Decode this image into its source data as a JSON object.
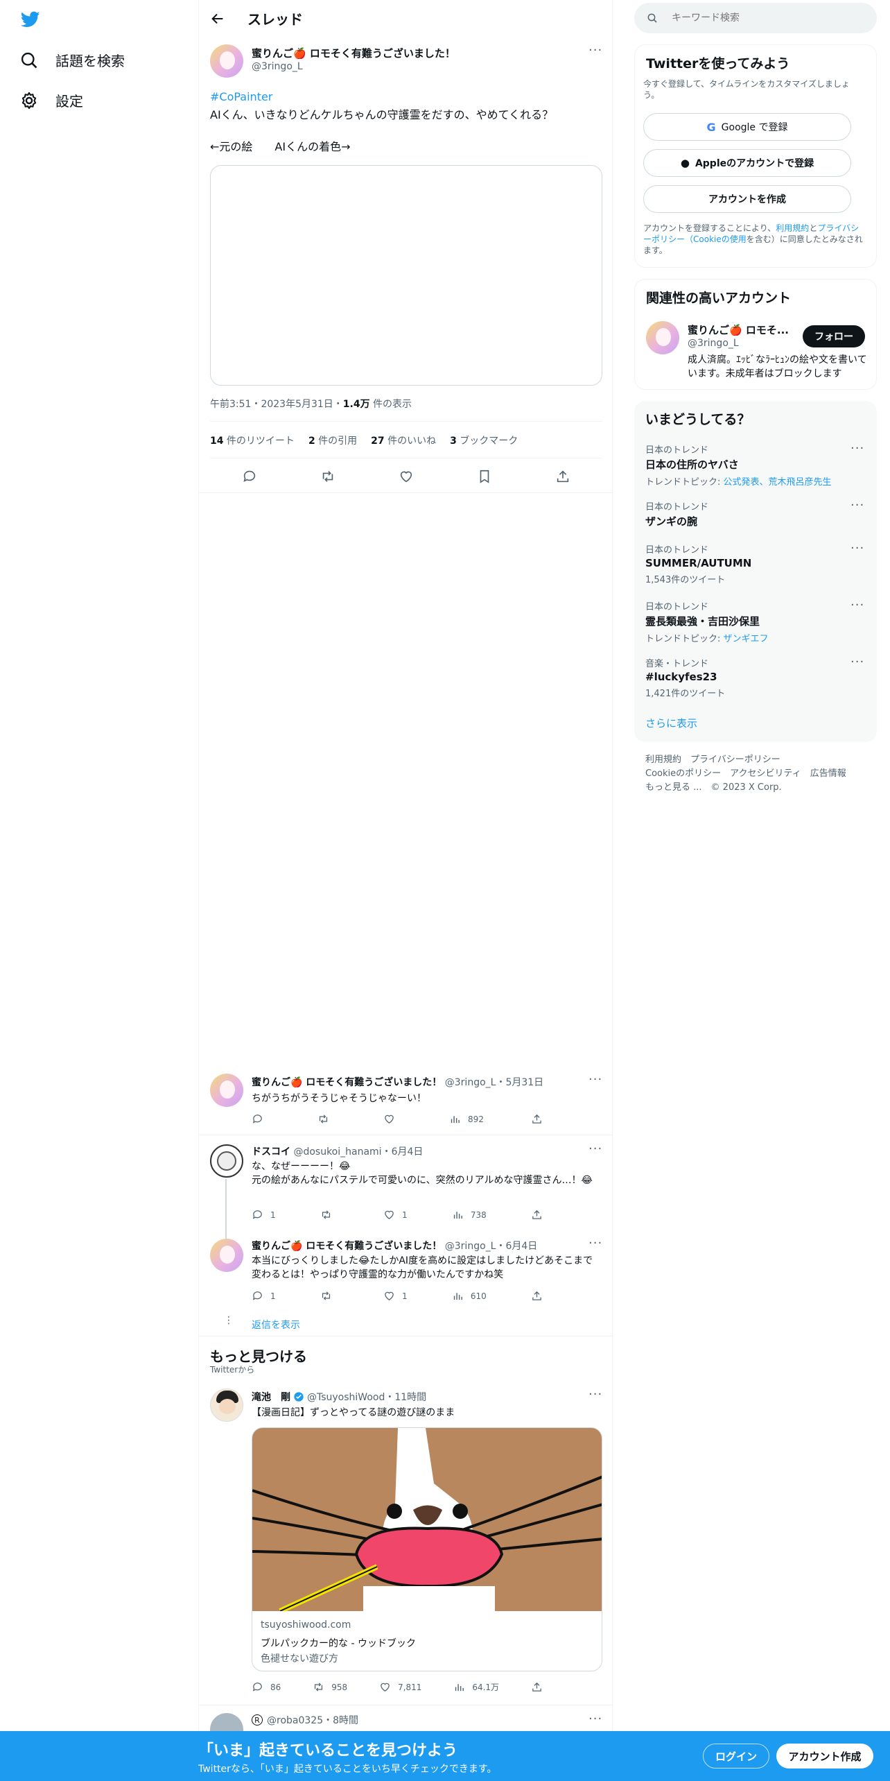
{
  "nav": {
    "explore": "話題を検索",
    "settings": "設定"
  },
  "header": {
    "title": "スレッド"
  },
  "main_tweet": {
    "author": "蜜りんご🍎 ロモそく有難うございました！",
    "handle": "@3ringo_L",
    "hashtag": "#CoPainter",
    "text": "AIくん、いきなりどんケルちゃんの守護霊をだすの、やめてくれる？",
    "caption": "←元の絵　　AIくんの着色→",
    "time": "午前3:51・2023年5月31日・",
    "views_num": "1.4万",
    "views_label": " 件の表示",
    "stats": {
      "retweets_num": "14",
      "retweets_label": " 件のリツイート",
      "quotes_num": "2",
      "quotes_label": " 件の引用",
      "likes_num": "27",
      "likes_label": " 件のいいね",
      "bookmarks_num": "3",
      "bookmarks_label": " ブックマーク"
    }
  },
  "replies": [
    {
      "author": "蜜りんご🍎 ロモそく有難うございました！",
      "meta": "@3ringo_L・5月31日",
      "text": "ちがうちがうそうじゃそうじゃなーい！",
      "reply": "",
      "retweet": "",
      "like": "",
      "views": "892"
    },
    {
      "author": "ドスコイ",
      "meta": "@dosukoi_hanami・6月4日",
      "text": "な、なぜーーーー！😂\n元の絵があんなにパステルで可愛いのに、突然のリアルめな守護霊さん…！😂",
      "reply": "1",
      "retweet": "",
      "like": "1",
      "views": "738"
    },
    {
      "author": "蜜りんご🍎 ロモそく有難うございました！",
      "meta": "@3ringo_L・6月4日",
      "text": "本当にびっくりしました😂たしかAI度を高めに設定はしましたけどあそこまで変わるとは！やっぱり守護霊的な力が働いたんですかね笑",
      "reply": "1",
      "retweet": "",
      "like": "1",
      "views": "610"
    }
  ],
  "show_replies": "返信を表示",
  "discover": {
    "title": "もっと見つける",
    "subtitle": "Twitterから"
  },
  "promo_tweet": {
    "author": "滝池　剛",
    "meta": "@TsuyoshiWood・11時間",
    "text": "【漫画日記】ずっとやってる謎の遊び謎のまま",
    "card_domain": "tsuyoshiwood.com",
    "card_title": "ブルパックカー的な - ウッドブック",
    "card_desc": "色褪せない遊び方",
    "reply": "86",
    "retweet": "958",
    "like": "7,811",
    "views": "64.1万"
  },
  "next_tweet": {
    "meta": "@roba0325・8時間"
  },
  "search": {
    "placeholder": "キーワード検索"
  },
  "signup": {
    "title": "Twitterを使ってみよう",
    "desc": "今すぐ登録して、タイムラインをカスタマイズしましょう。",
    "google": "Google で登録",
    "apple": "Appleのアカウントで登録",
    "create": "アカウントを作成",
    "terms_1": "アカウントを登録することにより、",
    "terms_link1": "利用規約",
    "terms_2": "と",
    "terms_link2": "プライバシーポリシー（Cookieの使用",
    "terms_3": "を含む）に同意したとみなされます。"
  },
  "related": {
    "title": "関連性の高いアカウント",
    "name": "蜜りんご🍎 ロモそ...",
    "handle": "@3ringo_L",
    "follow": "フォロー",
    "bio": "成人済腐。ｴｯﾋﾞなﾗｰﾋｭﾝの絵や文を書いています。未成年者はブロックします"
  },
  "trends": {
    "title": "いまどうしてる？",
    "items": [
      {
        "ctx": "日本のトレンド",
        "name": "日本の住所のヤバさ",
        "sub_prefix": "トレンドトピック: ",
        "sub_link": "公式発表、荒木飛呂彦先生"
      },
      {
        "ctx": "日本のトレンド",
        "name": "ザンギの腕",
        "sub_prefix": "",
        "sub_link": ""
      },
      {
        "ctx": "日本のトレンド",
        "name": "SUMMER/AUTUMN",
        "sub_prefix": "1,543件のツイート",
        "sub_link": ""
      },
      {
        "ctx": "日本のトレンド",
        "name": "霊長類最強・吉田沙保里",
        "sub_prefix": "トレンドトピック: ",
        "sub_link": "ザンギエフ"
      },
      {
        "ctx": "音楽・トレンド",
        "name": "#luckyfes23",
        "sub_prefix": "1,421件のツイート",
        "sub_link": ""
      }
    ],
    "show_more": "さらに表示"
  },
  "footer": {
    "l1": "利用規約",
    "l2": "プライバシーポリシー",
    "l3": "Cookieのポリシー",
    "l4": "アクセシビリティ",
    "l5": "広告情報",
    "l6": "もっと見る ...",
    "copy": "© 2023 X Corp."
  },
  "bottom": {
    "title": "「いま」起きていることを見つけよう",
    "sub": "Twitterなら、「いま」起きていることをいち早くチェックできます。",
    "login": "ログイン",
    "signup": "アカウント作成"
  },
  "colors": {
    "accent": "#1d9bf0",
    "text": "#0f1419",
    "muted": "#536471"
  }
}
